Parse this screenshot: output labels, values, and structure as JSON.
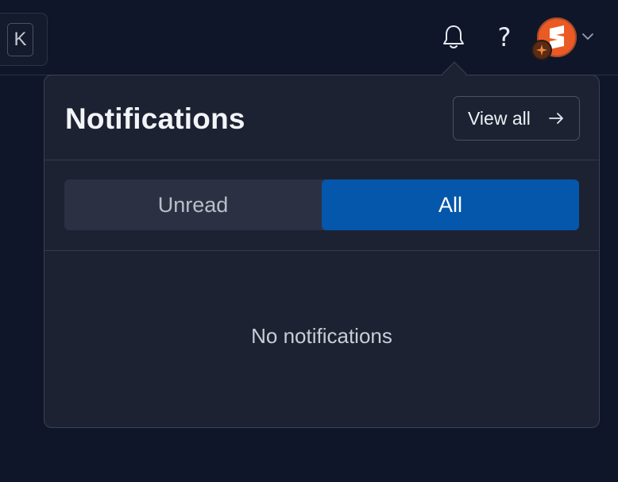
{
  "topbar": {
    "shortcut_key": "K",
    "bell_icon": "bell-icon",
    "help_label": "?",
    "avatar_icon": "brand-logo-icon",
    "avatar_color": "#eb5a24",
    "chevron_icon": "chevron-down-icon"
  },
  "notifications": {
    "title": "Notifications",
    "view_all_label": "View all",
    "tabs": [
      {
        "label": "Unread",
        "active": false
      },
      {
        "label": "All",
        "active": true
      }
    ],
    "empty_text": "No notifications"
  },
  "colors": {
    "background": "#0f1629",
    "panel": "#1c2232",
    "active_tab": "#0457aa"
  }
}
